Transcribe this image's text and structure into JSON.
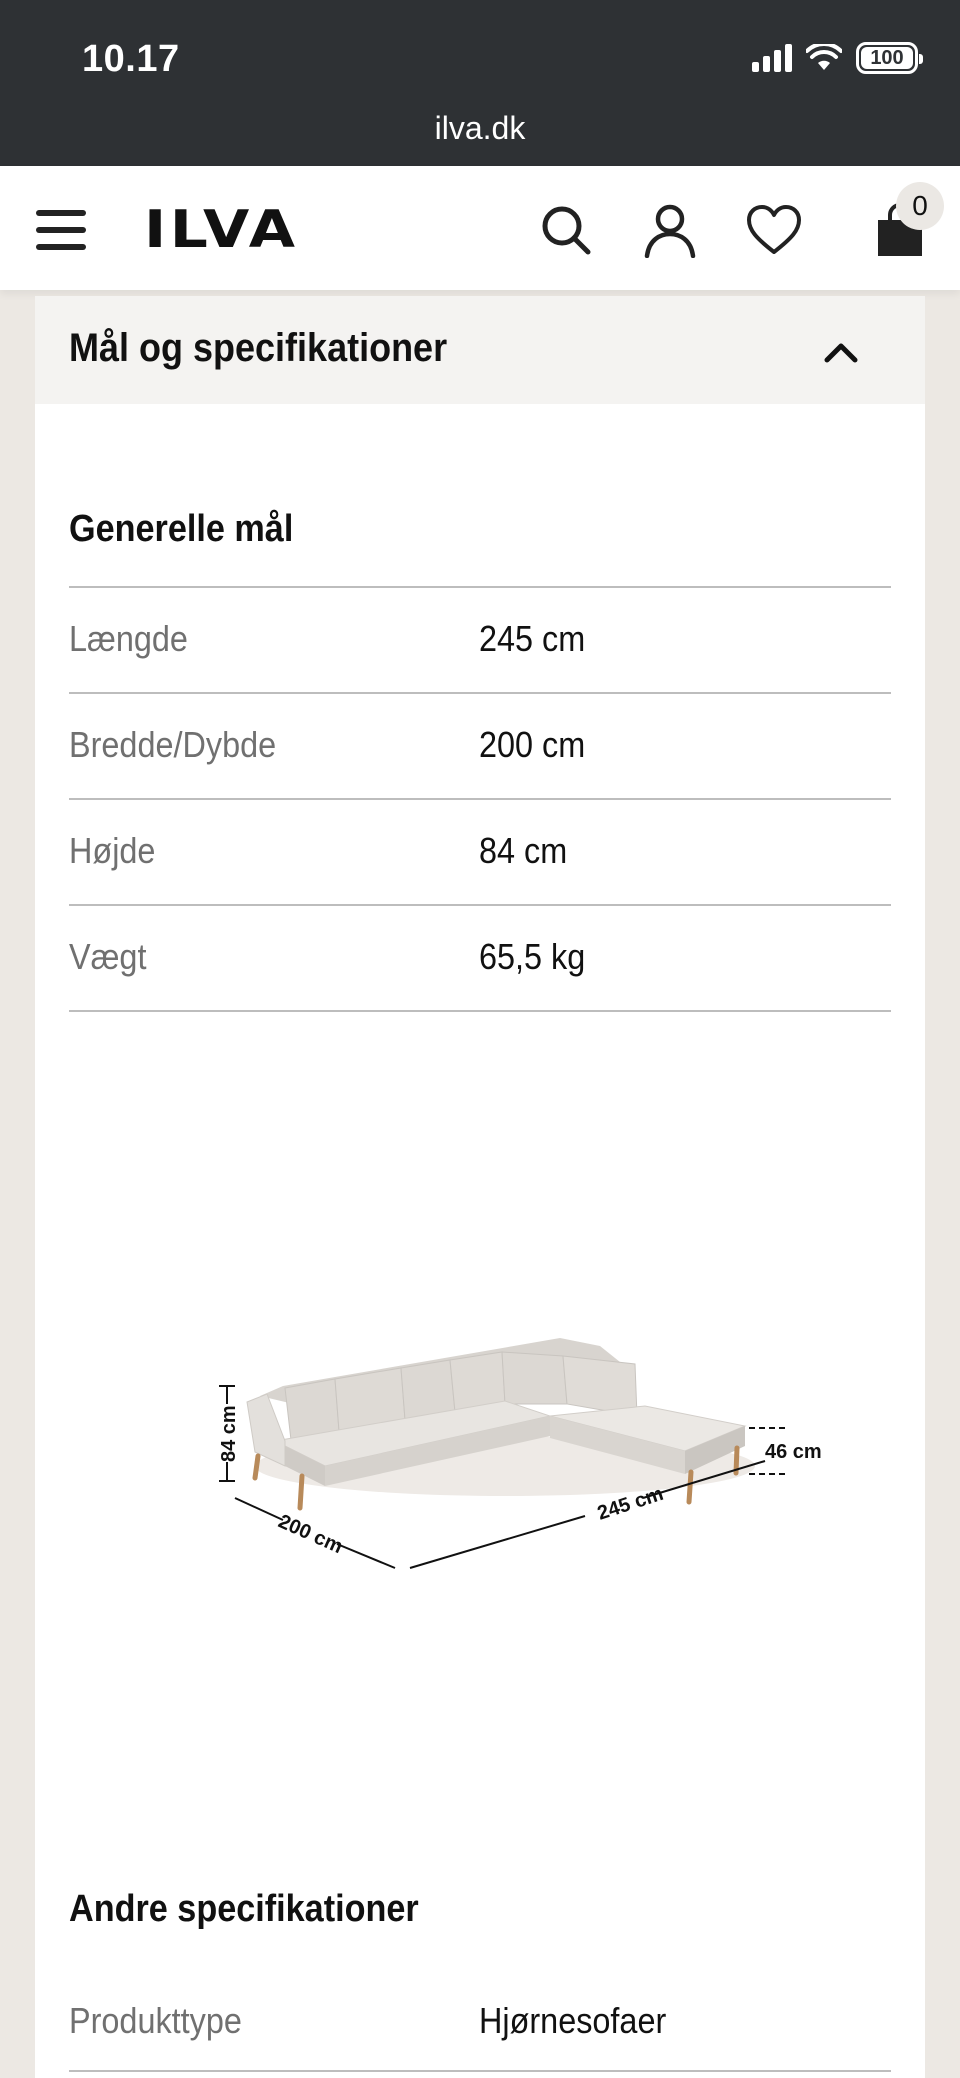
{
  "status_bar": {
    "time": "10.17",
    "battery": "100",
    "url": "ilva.dk"
  },
  "header": {
    "logo": "ILVA",
    "icons": [
      "menu-icon",
      "search-icon",
      "user-icon",
      "heart-icon",
      "bag-icon"
    ],
    "cart_count": "0"
  },
  "accordion": {
    "title": "Mål og specifikationer",
    "state": "expanded"
  },
  "general": {
    "title": "Generelle mål",
    "rows": [
      {
        "label": "Længde",
        "value": "245 cm"
      },
      {
        "label": "Bredde/Dybde",
        "value": "200 cm"
      },
      {
        "label": "Højde",
        "value": "84 cm"
      },
      {
        "label": "Vægt",
        "value": "65,5 kg"
      }
    ]
  },
  "diagram": {
    "height_label": "84 cm",
    "depth_label": "200 cm",
    "length_label": "245 cm",
    "seat_label": "46 cm"
  },
  "other": {
    "title": "Andre specifikationer",
    "rows": [
      {
        "label": "Produkttype",
        "value": "Hjørnesofaer"
      }
    ]
  },
  "colors": {
    "status_bar": "#2e3134",
    "page_bg": "#ece8e3",
    "accordion_bg": "#f4f3f1",
    "label_gray": "#707070"
  }
}
